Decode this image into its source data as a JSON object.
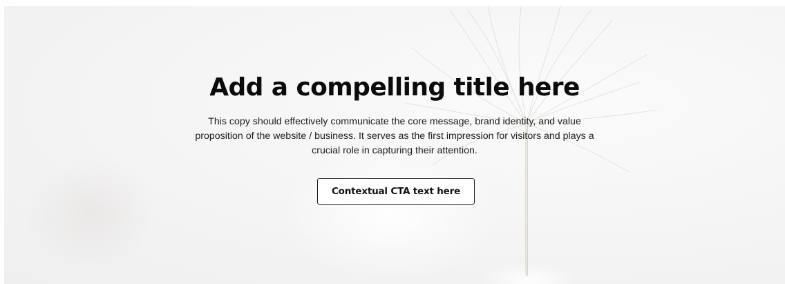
{
  "hero": {
    "background_image": "dandelion-seed-photo",
    "background_color": "#f3f2f2",
    "title": "Add a compelling title here",
    "description": "This copy should effectively communicate the core message, brand identity, and value proposition of the website / business. It serves as the first impression for visitors and plays a crucial role in capturing their attention.",
    "cta_label": "Contextual CTA text here"
  },
  "colors": {
    "text": "#0b0b0b",
    "button_border": "#1a1a1a",
    "button_background": "#ffffff"
  }
}
